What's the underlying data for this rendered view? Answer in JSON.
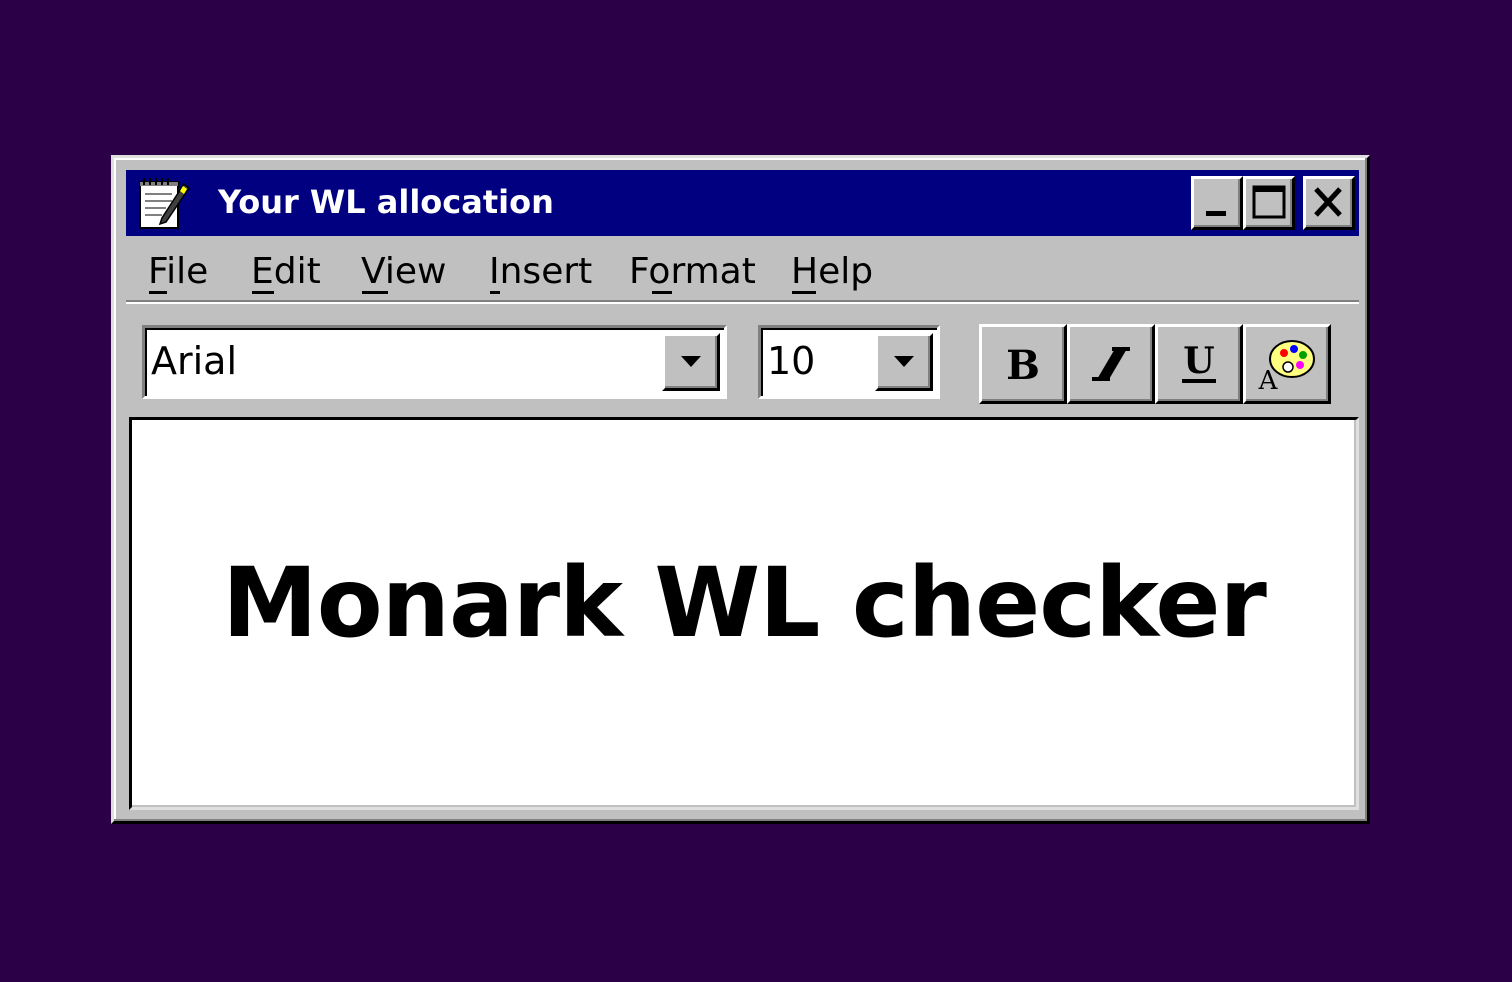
{
  "window": {
    "title": "Your WL allocation",
    "app_icon": "notepad-pen-icon",
    "controls": {
      "minimize_icon": "minimize-icon",
      "maximize_icon": "maximize-icon",
      "close_icon": "close-icon"
    }
  },
  "menubar": {
    "items": [
      {
        "label": "File",
        "mnemonic": "F"
      },
      {
        "label": "Edit",
        "mnemonic": "E"
      },
      {
        "label": "View",
        "mnemonic": "V"
      },
      {
        "label": "Insert",
        "mnemonic": "I"
      },
      {
        "label": "Format",
        "mnemonic": "o"
      },
      {
        "label": "Help",
        "mnemonic": "H"
      }
    ]
  },
  "toolbar": {
    "font_name": "Arial",
    "font_size": "10",
    "dropdown_icon": "dropdown-arrow-icon",
    "buttons": [
      "bold-icon",
      "italic-icon",
      "underline-icon",
      "color-palette-icon"
    ]
  },
  "document": {
    "text": "Monark WL checker"
  },
  "colors": {
    "desktop": "#2c0046",
    "titlebar": "#000080",
    "face": "#c0c0c0"
  }
}
